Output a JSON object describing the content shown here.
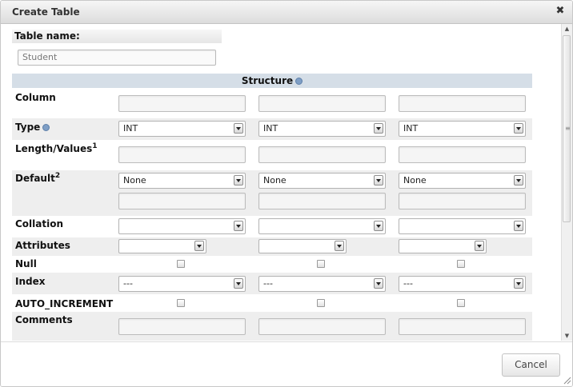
{
  "dialog": {
    "title": "Create Table",
    "close_icon": "close-icon",
    "close_glyph": "✖",
    "table_name_label": "Table name:",
    "table_name_value": "Student",
    "structure_header": "Structure",
    "cancel_label": "Cancel"
  },
  "rows": {
    "column": "Column",
    "type": "Type",
    "length": "Length/Values",
    "length_sup": "1",
    "default": "Default",
    "default_sup": "2",
    "collation": "Collation",
    "attributes": "Attributes",
    "null": "Null",
    "index": "Index",
    "auto_increment": "AUTO_INCREMENT",
    "comments": "Comments"
  },
  "columns": [
    {
      "type": "INT",
      "default": "None",
      "index": "---"
    },
    {
      "type": "INT",
      "default": "None",
      "index": "---"
    },
    {
      "type": "INT",
      "default": "None",
      "index": "---"
    }
  ]
}
